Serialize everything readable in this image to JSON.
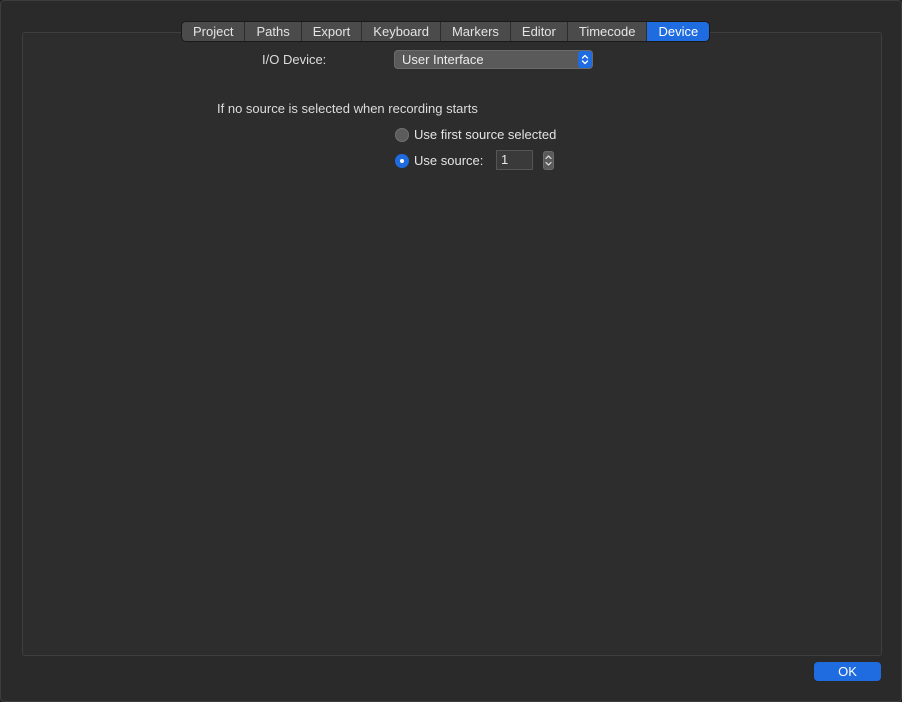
{
  "tabs": [
    {
      "label": "Project",
      "active": false
    },
    {
      "label": "Paths",
      "active": false
    },
    {
      "label": "Export",
      "active": false
    },
    {
      "label": "Keyboard",
      "active": false
    },
    {
      "label": "Markers",
      "active": false
    },
    {
      "label": "Editor",
      "active": false
    },
    {
      "label": "Timecode",
      "active": false
    },
    {
      "label": "Device",
      "active": true
    }
  ],
  "device": {
    "io_label": "I/O Device:",
    "io_value": "User Interface",
    "section_title": "If no source is selected when recording starts",
    "option_first": "Use first source selected",
    "option_source": "Use source:",
    "selected_option": "use-source",
    "source_value": "1"
  },
  "footer": {
    "ok_label": "OK"
  },
  "colors": {
    "accent": "#1f6be0",
    "background": "#2a2a2a",
    "panel": "#2d2d2d"
  }
}
